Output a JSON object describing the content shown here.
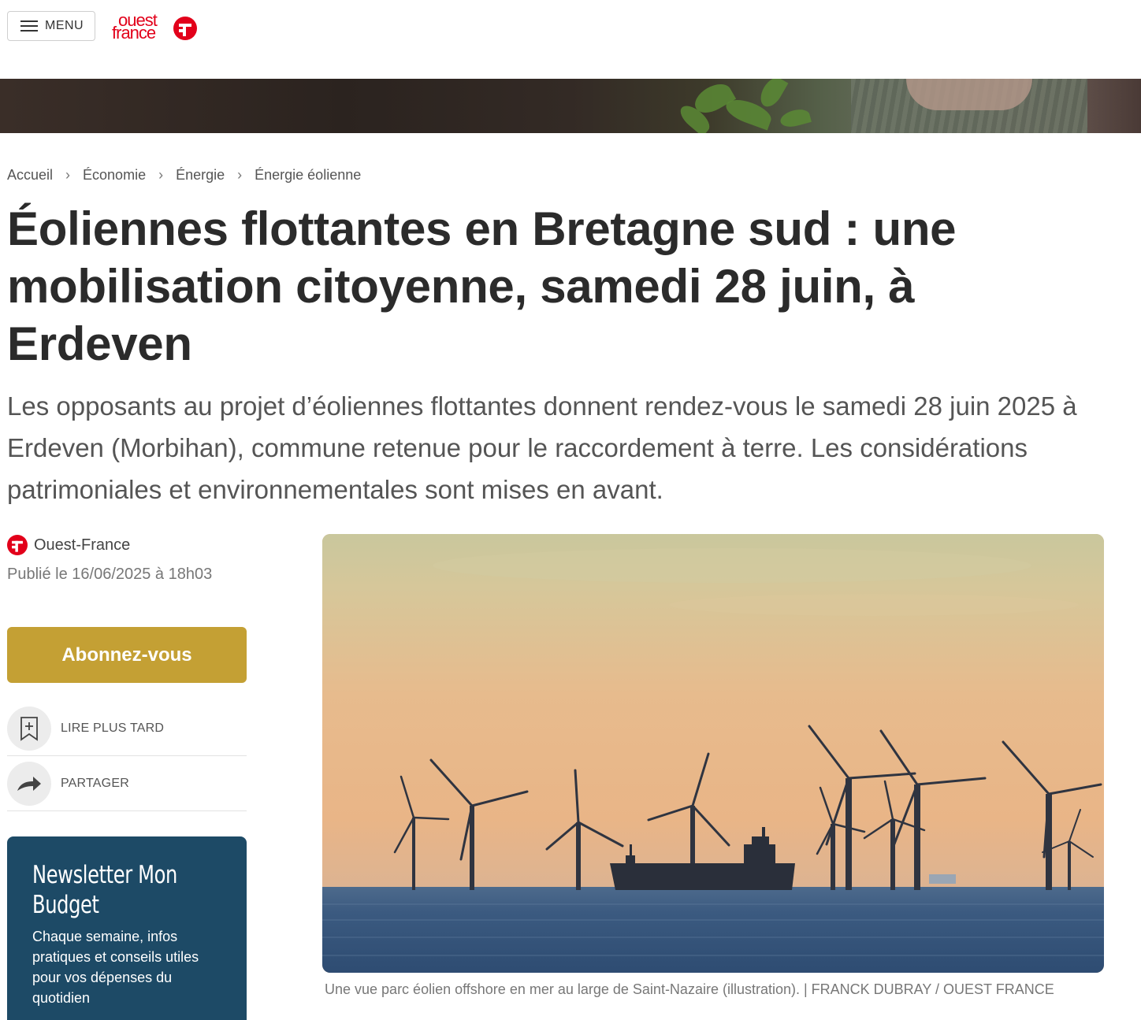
{
  "header": {
    "menu_label": "MENU",
    "logo_line1": "ouest",
    "logo_line2": "france",
    "brand_color": "#e2001a"
  },
  "breadcrumb": {
    "items": [
      {
        "label": "Accueil"
      },
      {
        "label": "Économie"
      },
      {
        "label": "Énergie"
      },
      {
        "label": "Énergie éolienne"
      }
    ],
    "separator": "›"
  },
  "article": {
    "title": "Éoliennes flottantes en Bretagne sud : une mobilisation citoyenne, samedi 28 juin, à Erdeven",
    "lead": "Les opposants au projet d’éoliennes flottantes donnent rendez-vous le samedi 28 juin 2025 à Erdeven (Morbihan), commune retenue pour le raccordement à terre. Les considérations patrimoniales et environnementales sont mises en avant.",
    "author": "Ouest-France",
    "published": "Publié le 16/06/2025 à 18h03",
    "image_caption": "Une vue parc éolien offshore en mer au large de Saint-Nazaire (illustration). | FRANCK DUBRAY / OUEST FRANCE"
  },
  "sidebar": {
    "subscribe_label": "Abonnez-vous",
    "subscribe_color": "#c4a034",
    "actions": [
      {
        "label": "LIRE PLUS TARD",
        "icon": "bookmark-plus-icon"
      },
      {
        "label": "PARTAGER",
        "icon": "share-arrow-icon"
      }
    ],
    "newsletter": {
      "title": "Newsletter Mon Budget",
      "description": "Chaque semaine, infos pratiques et conseils utiles pour vos dépenses du quotidien",
      "background": "#1d4a66"
    }
  }
}
